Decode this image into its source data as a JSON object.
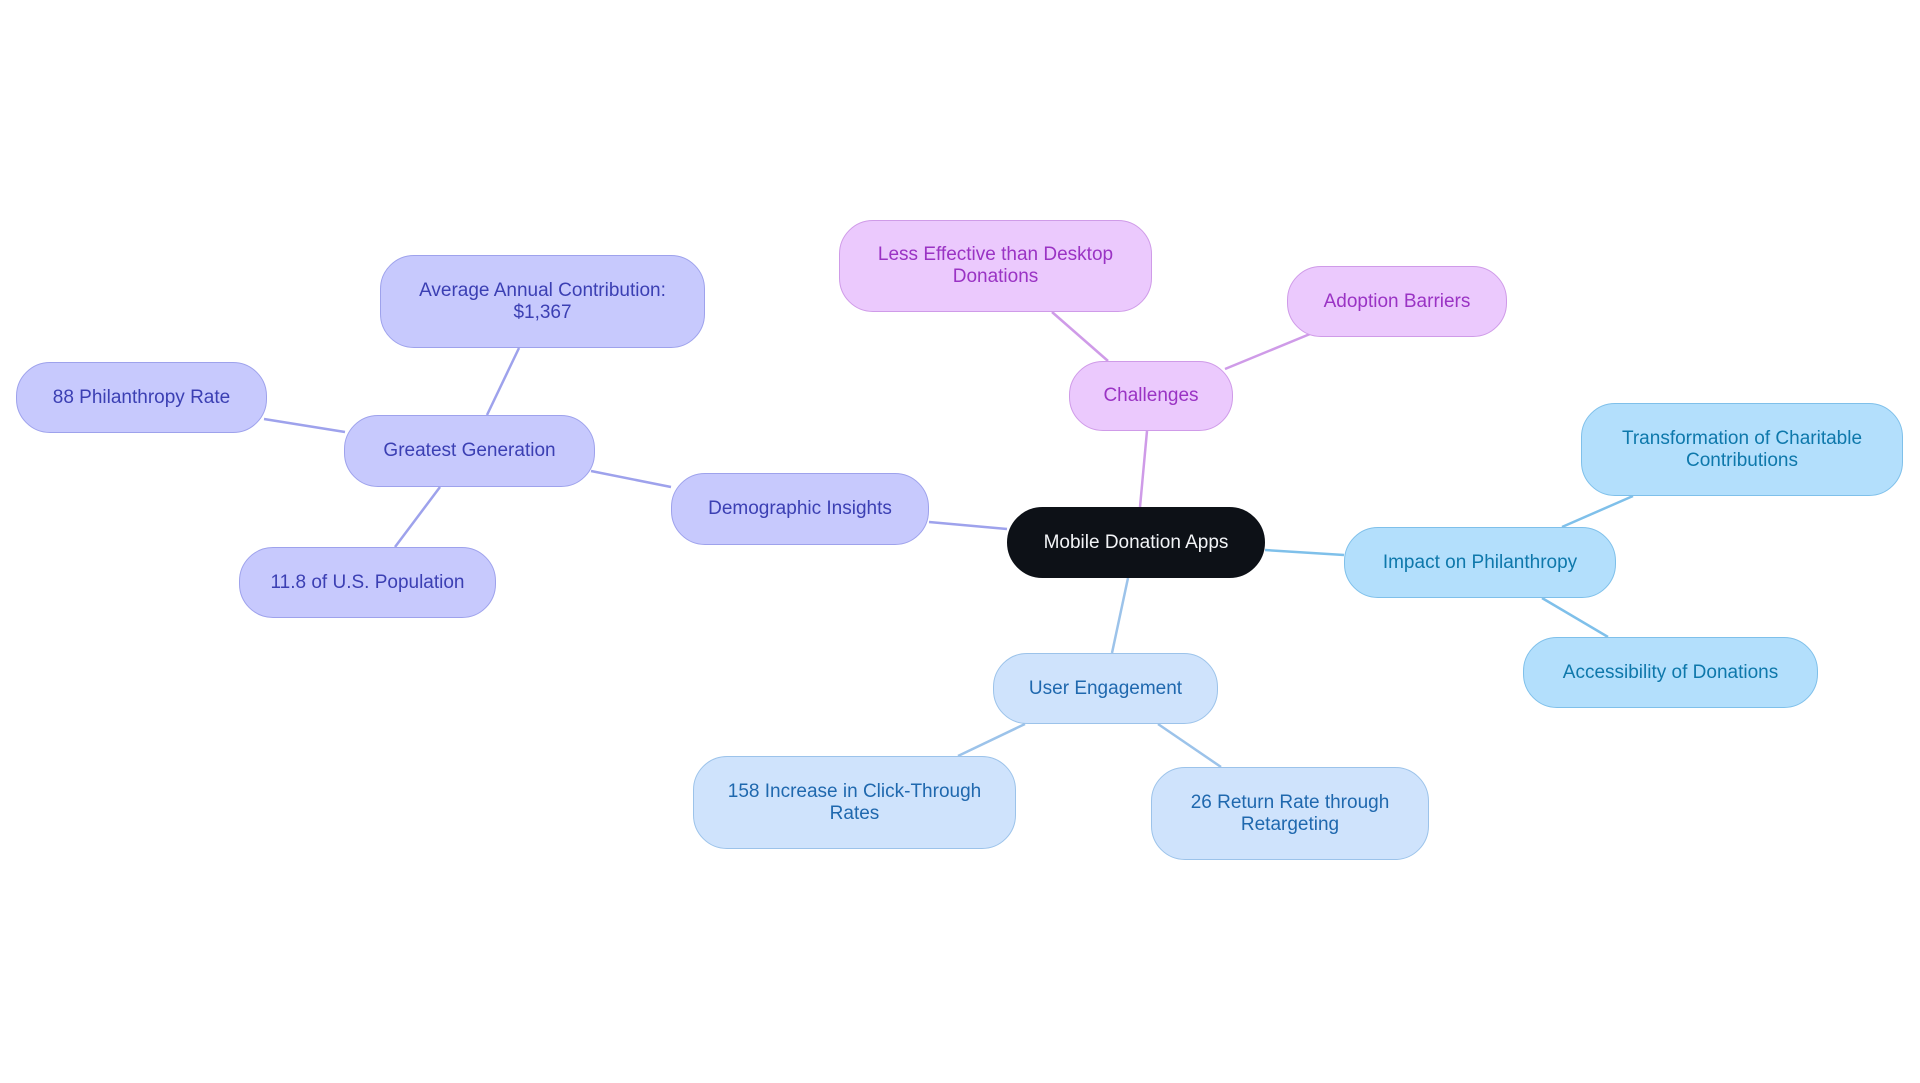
{
  "diagram": {
    "type": "mind-map",
    "root": {
      "id": "root",
      "label": "Mobile Donation Apps"
    },
    "nodes": [
      {
        "id": "demographic",
        "label": "Demographic Insights",
        "parent": "root",
        "color": "indigo"
      },
      {
        "id": "greatest",
        "label": "Greatest Generation",
        "parent": "demographic",
        "color": "indigo"
      },
      {
        "id": "avg",
        "label": "Average Annual Contribution: $1,367",
        "parent": "greatest",
        "color": "indigo"
      },
      {
        "id": "rate88",
        "label": "88 Philanthropy Rate",
        "parent": "greatest",
        "color": "indigo"
      },
      {
        "id": "pop",
        "label": "11.8 of U.S. Population",
        "parent": "greatest",
        "color": "indigo"
      },
      {
        "id": "challenges",
        "label": "Challenges",
        "parent": "root",
        "color": "violet"
      },
      {
        "id": "lesseff",
        "label": "Less Effective than Desktop Donations",
        "parent": "challenges",
        "color": "violet"
      },
      {
        "id": "adoption",
        "label": "Adoption Barriers",
        "parent": "challenges",
        "color": "violet"
      },
      {
        "id": "impact",
        "label": "Impact on Philanthropy",
        "parent": "root",
        "color": "sky"
      },
      {
        "id": "transform",
        "label": "Transformation of Charitable Contributions",
        "parent": "impact",
        "color": "sky"
      },
      {
        "id": "access",
        "label": "Accessibility of Donations",
        "parent": "impact",
        "color": "sky"
      },
      {
        "id": "engagement",
        "label": "User Engagement",
        "parent": "root",
        "color": "azure"
      },
      {
        "id": "ctr",
        "label": "158 Increase in Click-Through Rates",
        "parent": "engagement",
        "color": "azure"
      },
      {
        "id": "ret",
        "label": "26 Return Rate through Retargeting",
        "parent": "engagement",
        "color": "azure"
      }
    ],
    "colors": {
      "root_fill": "#0d1117",
      "indigo_edge": "#9ea2ec",
      "violet_edge": "#cf9be8",
      "sky_edge": "#7fc0ea",
      "azure_edge": "#9cc3ea"
    }
  }
}
